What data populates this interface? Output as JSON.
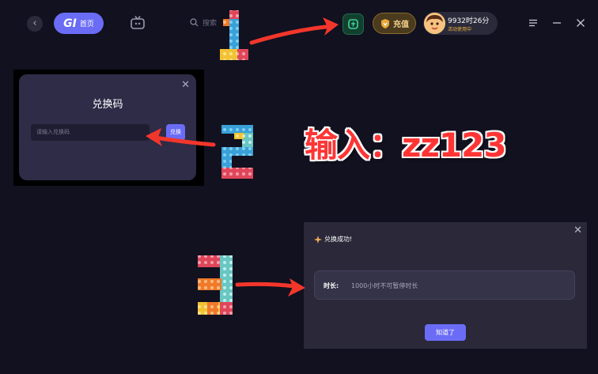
{
  "header": {
    "back_icon": "chevron-left-icon",
    "home_logo": "GI",
    "home_label": "首页",
    "search_placeholder": "搜索",
    "recharge_label": "充值",
    "user_time": "9932时26分",
    "user_status": "活动使用中"
  },
  "redeem_dialog": {
    "title": "兑换码",
    "input_placeholder": "请输入兑换码",
    "submit_label": "兑换"
  },
  "annotation": {
    "text": "输入：zz123",
    "step_labels": [
      "1",
      "2",
      "3"
    ]
  },
  "success_dialog": {
    "title": "兑换成功!",
    "duration_label": "时长:",
    "duration_value": "1000小时不可暂停时长",
    "ok_label": "知道了"
  },
  "colors": {
    "background": "#11111f",
    "accent": "#6b6cf6",
    "annotation_red": "#ff3535",
    "gold": "#f3d28a"
  }
}
